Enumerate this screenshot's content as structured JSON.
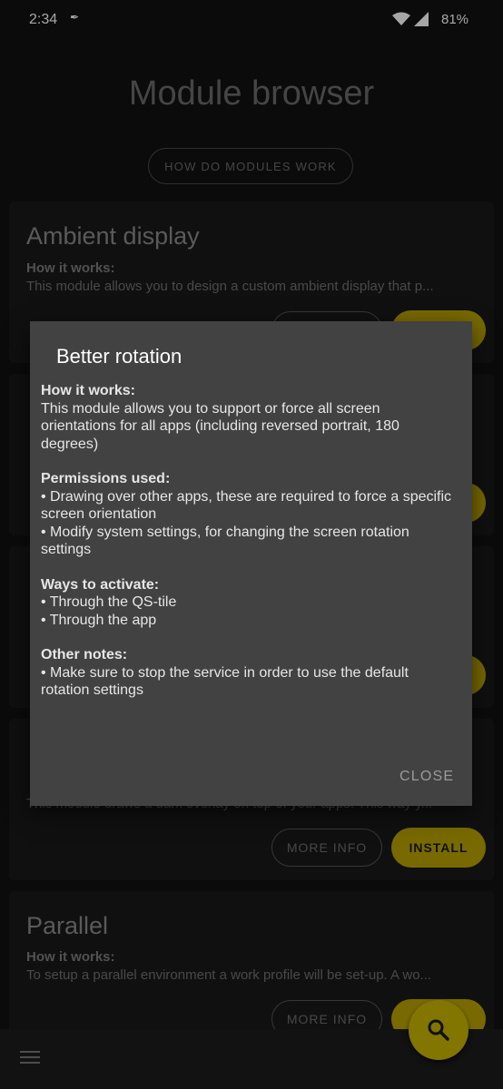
{
  "status": {
    "time": "2:34",
    "battery": "81%"
  },
  "page": {
    "title": "Module browser",
    "how_button": "HOW DO MODULES WORK"
  },
  "modules": [
    {
      "name": "Ambient display",
      "how_label": "How it works:",
      "desc": "This module allows you to design a custom ambient display that p..."
    },
    {
      "name": "Parallel",
      "how_label": "How it works:",
      "desc": "To setup a parallel environment a work profile will be set-up. A wo..."
    }
  ],
  "partial": {
    "desc": "This module draws a dark overlay on top of your apps. This way y..."
  },
  "buttons": {
    "more": "MORE INFO",
    "install": "INSTALL"
  },
  "dialog": {
    "title": "Better rotation",
    "sections": [
      {
        "heading": "How it works:",
        "lines": [
          "This module allows you to support or force all screen orientations for all apps (including reversed portrait, 180 degrees)"
        ]
      },
      {
        "heading": "Permissions used:",
        "lines": [
          "• Drawing over other apps, these are required to force a specific screen orientation",
          "• Modify system settings, for changing the screen rotation settings"
        ]
      },
      {
        "heading": "Ways to activate:",
        "lines": [
          "• Through the QS-tile",
          "• Through the app"
        ]
      },
      {
        "heading": "Other notes:",
        "lines": [
          "• Make sure to stop the service in order to use the default rotation settings"
        ]
      }
    ],
    "close": "CLOSE"
  },
  "icons": {
    "fab": "search-icon",
    "menu": "menu-icon"
  },
  "colors": {
    "accent": "#c8b400",
    "dialog_bg": "#424242",
    "background": "#121212"
  }
}
